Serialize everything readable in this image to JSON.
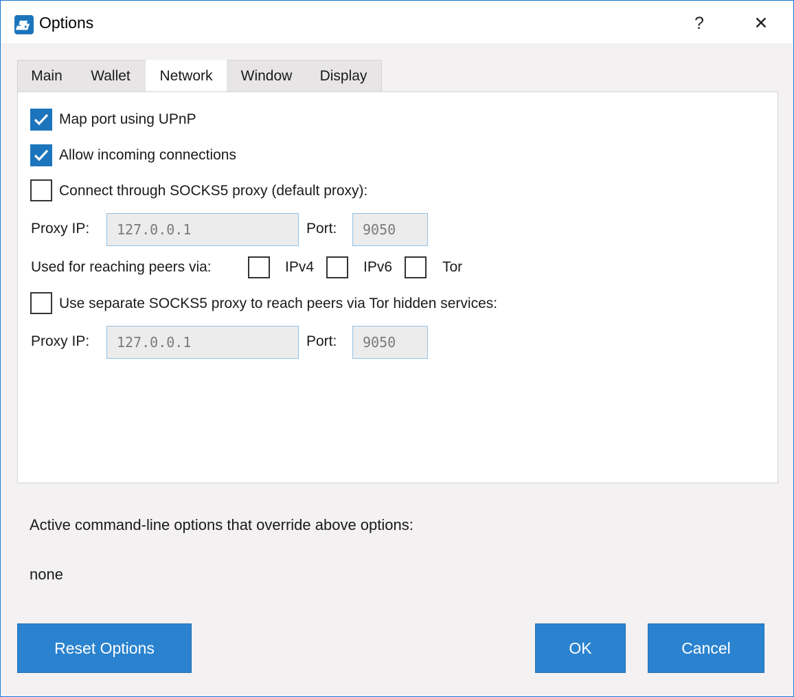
{
  "window": {
    "title": "Options",
    "help_glyph": "?",
    "close_glyph": "✕",
    "app_icon": "dash-logo-icon",
    "accent_color": "#1c75bc"
  },
  "tabs": [
    {
      "label": "Main",
      "active": false
    },
    {
      "label": "Wallet",
      "active": false
    },
    {
      "label": "Network",
      "active": true
    },
    {
      "label": "Window",
      "active": false
    },
    {
      "label": "Display",
      "active": false
    }
  ],
  "network": {
    "upnp": {
      "label": "Map port using UPnP",
      "checked": true
    },
    "incoming": {
      "label": "Allow incoming connections",
      "checked": true
    },
    "socks5": {
      "label": "Connect through SOCKS5 proxy (default proxy):",
      "checked": false
    },
    "proxy1": {
      "ip_label": "Proxy IP:",
      "ip_value": "127.0.0.1",
      "port_label": "Port:",
      "port_value": "9050"
    },
    "reach": {
      "label": "Used for reaching peers via:",
      "ipv4": {
        "label": "IPv4",
        "checked": false
      },
      "ipv6": {
        "label": "IPv6",
        "checked": false
      },
      "tor": {
        "label": "Tor",
        "checked": false
      }
    },
    "separate": {
      "label": "Use separate SOCKS5 proxy to reach peers via Tor hidden services:",
      "checked": false
    },
    "proxy2": {
      "ip_label": "Proxy IP:",
      "ip_value": "127.0.0.1",
      "port_label": "Port:",
      "port_value": "9050"
    }
  },
  "cmdline": {
    "label": "Active command-line options that override above options:",
    "value": "none"
  },
  "buttons": {
    "reset": "Reset Options",
    "ok": "OK",
    "cancel": "Cancel"
  }
}
